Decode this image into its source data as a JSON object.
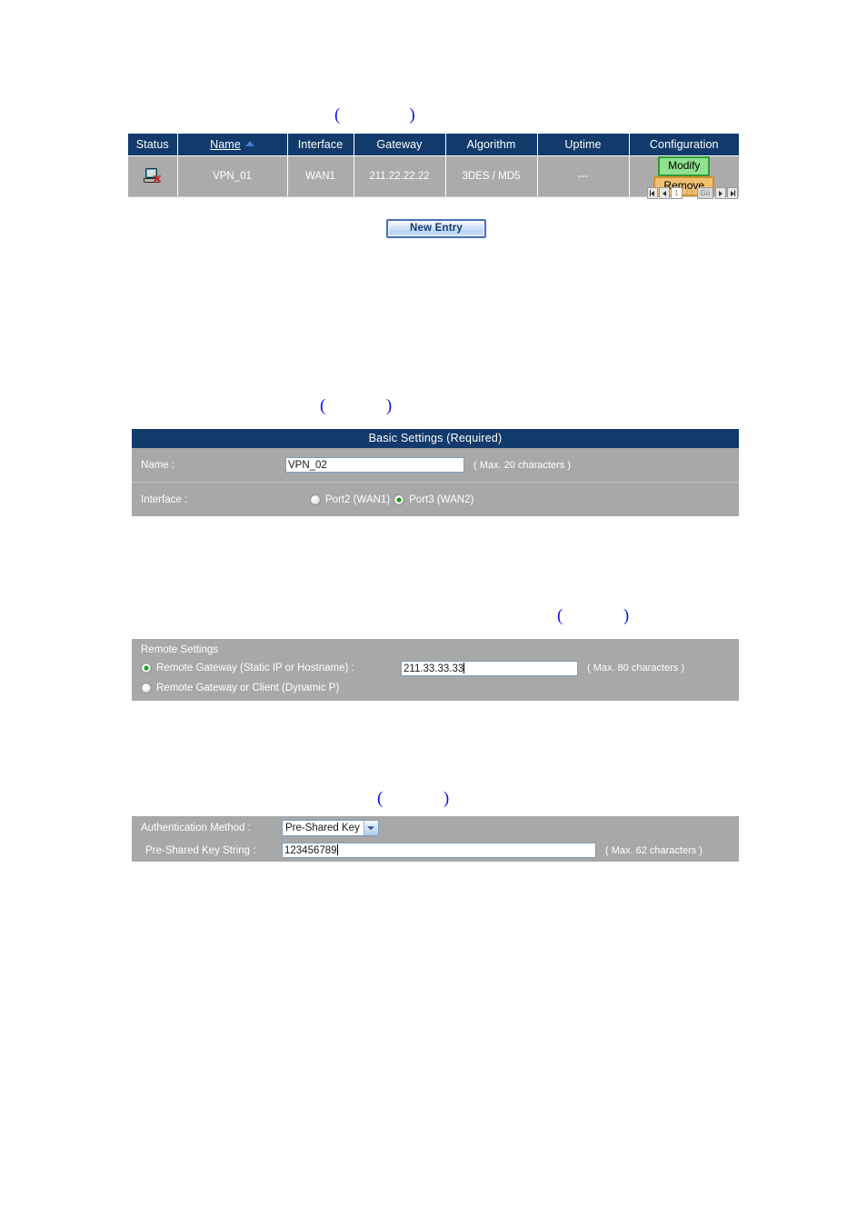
{
  "annotations": {
    "list_table_note": "(                )",
    "basic_settings_note": "(              )",
    "remote_settings_note": "(              )",
    "authentication_note": "(              )"
  },
  "vpn_list": {
    "columns": [
      "Status",
      "Name",
      "Interface",
      "Gateway",
      "Algorithm",
      "Uptime",
      "Configuration"
    ],
    "sorted_column": "Name",
    "sort_direction": "ascending",
    "rows": [
      {
        "status_icon": "disconnected-computer-icon",
        "name": "VPN_01",
        "interface": "WAN1",
        "gateway": "211.22.22.22",
        "algorithm": "3DES / MD5",
        "uptime": "---",
        "modify_label": "Modify",
        "remove_label": "Remove"
      }
    ],
    "pagination": {
      "first_icon": "first-page-icon",
      "prev_icon": "previous-page-icon",
      "current_page": "1",
      "separator": "/",
      "total_pages": "1",
      "go_label": "Go",
      "next_icon": "next-page-icon",
      "last_icon": "last-page-icon"
    },
    "new_entry_label": "New Entry"
  },
  "basic_settings": {
    "title": "Basic Settings (Required)",
    "name_label": "Name :",
    "name_value": "VPN_02",
    "name_hint": "( Max. 20 characters )",
    "interface_label": "Interface :",
    "interface_options": [
      {
        "label": "Port2 (WAN1)",
        "selected": false
      },
      {
        "label": "Port3 (WAN2)",
        "selected": true
      }
    ]
  },
  "remote_settings": {
    "title": "Remote Settings",
    "gateway_static_label": "Remote Gateway (Static IP or Hostname) :",
    "gateway_static_selected": true,
    "gateway_value": "211.33.33.33",
    "gateway_hint": "( Max. 80 characters )",
    "gateway_dynamic_label": "Remote Gateway or Client (Dynamic P)",
    "gateway_dynamic_selected": false
  },
  "authentication": {
    "method_label": "Authentication Method :",
    "method_value": "Pre-Shared Key",
    "key_label": "Pre-Shared Key String :",
    "key_value": "123456789",
    "key_hint": "( Max. 62 characters )"
  },
  "colors": {
    "header_navy": "#123a6b",
    "row_gray": "#ababab",
    "panel_gray": "#a8a8a8",
    "annotation_blue": "#1111ee",
    "modify_green": "#8fe08f",
    "remove_orange": "#f0c071",
    "radio_dot_green": "#15a015"
  }
}
